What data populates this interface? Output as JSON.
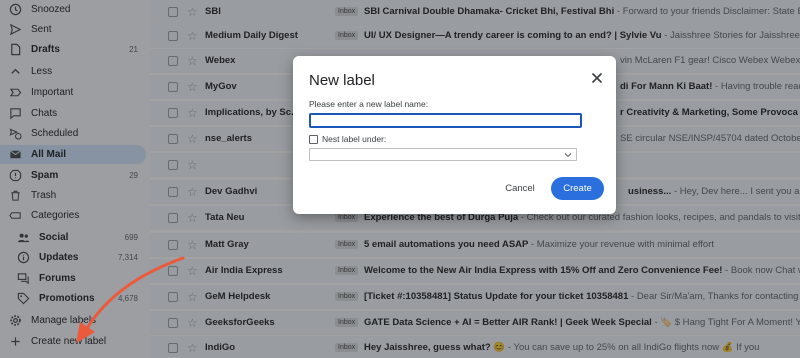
{
  "sidebar": {
    "items": [
      {
        "label": "Snoozed",
        "icon": "clock-icon",
        "count": ""
      },
      {
        "label": "Sent",
        "icon": "send-icon",
        "count": ""
      },
      {
        "label": "Drafts",
        "icon": "draft-icon",
        "count": "21"
      },
      {
        "label": "Less",
        "icon": "chevron-up-icon",
        "count": ""
      },
      {
        "label": "Important",
        "icon": "label-important-icon",
        "count": ""
      },
      {
        "label": "Chats",
        "icon": "chat-icon",
        "count": ""
      },
      {
        "label": "Scheduled",
        "icon": "scheduled-send-icon",
        "count": ""
      },
      {
        "label": "All Mail",
        "icon": "all-mail-icon",
        "count": ""
      },
      {
        "label": "Spam",
        "icon": "spam-icon",
        "count": "29"
      },
      {
        "label": "Trash",
        "icon": "trash-icon",
        "count": ""
      },
      {
        "label": "Categories",
        "icon": "label-outline-icon",
        "count": ""
      }
    ],
    "categories": [
      {
        "label": "Social",
        "icon": "people-icon",
        "count": "699"
      },
      {
        "label": "Updates",
        "icon": "info-icon",
        "count": "7,314"
      },
      {
        "label": "Forums",
        "icon": "forum-icon",
        "count": ""
      },
      {
        "label": "Promotions",
        "icon": "tag-icon",
        "count": "4,678"
      }
    ],
    "manage_label": "Manage labels",
    "create_label": "Create new label"
  },
  "mail": {
    "badge": "Inbox",
    "rows": [
      {
        "sender": "SBI",
        "subject": "SBI Carnival Double Dhamaka- Cricket Bhi, Festival Bhi",
        "snippet": " - Forward to your friends Disclaimer: State Ba"
      },
      {
        "sender": "Medium Daily Digest",
        "subject": "UI/ UX Designer—A trendy career is coming to an end? | Sylvie Vu",
        "snippet": " - Jaisshree Stories for Jaisshree @"
      },
      {
        "sender": "Webex",
        "subject": "",
        "snippet": "vin McLaren F1 gear! Cisco Webex Webex L"
      },
      {
        "sender": "MyGov",
        "subject": "di For Mann Ki Baat!",
        "snippet": " - Having trouble read"
      },
      {
        "sender": "Implications, by Sc.",
        "subject": "r Creativity & Marketing, Some Provoca",
        "snippet": ""
      },
      {
        "sender": "nse_alerts",
        "subject": "",
        "snippet": "SE circular NSE/INSP/45704 dated Octobe"
      },
      {
        "sender": "",
        "subject": "",
        "snippet": ""
      },
      {
        "sender": "Dev Gadhvi",
        "subject": "usiness...",
        "snippet": " - Hey, Dev here... I sent you an e"
      },
      {
        "sender": "Tata Neu",
        "subject": "Experience the best of Durga Puja",
        "snippet": " - Check out our curated fashion looks, recipes, and pandals to visit"
      },
      {
        "sender": "Matt Gray",
        "subject": "5 email automations you need ASAP",
        "snippet": " - Maximize your revenue with minimal effort"
      },
      {
        "sender": "Air India Express",
        "subject": "Welcome to the New Air India Express with 15% Off and Zero Convenience Fee!",
        "snippet": " - Book now Chat wit"
      },
      {
        "sender": "GeM Helpdesk",
        "subject": "[Ticket #:10358481] Status Update for your ticket 10358481",
        "snippet": " - Dear Sir/Ma'am, Thanks for contacting G"
      },
      {
        "sender": "GeeksforGeeks",
        "subject": "GATE Data Science + AI = Better AIR Rank! | Geek Week Special",
        "snippet": " - 🏷️ $ Hang Tight For A Moment! You"
      },
      {
        "sender": "IndiGo",
        "subject": "Hey Jaisshree, guess what?",
        "snippet": " 😊 - You can save up to 25% on all IndiGo flights now 💰 If you"
      }
    ]
  },
  "dialog": {
    "title": "New label",
    "prompt": "Please enter a new label name:",
    "input_value": "",
    "nest_label": "Nest label under:",
    "nest_selected": "",
    "cancel_label": "Cancel",
    "create_label": "Create"
  },
  "colors": {
    "accent": "#2b6ede",
    "annotation_arrow": "#ec5a3c",
    "active_nav": "#d3e3fd"
  }
}
